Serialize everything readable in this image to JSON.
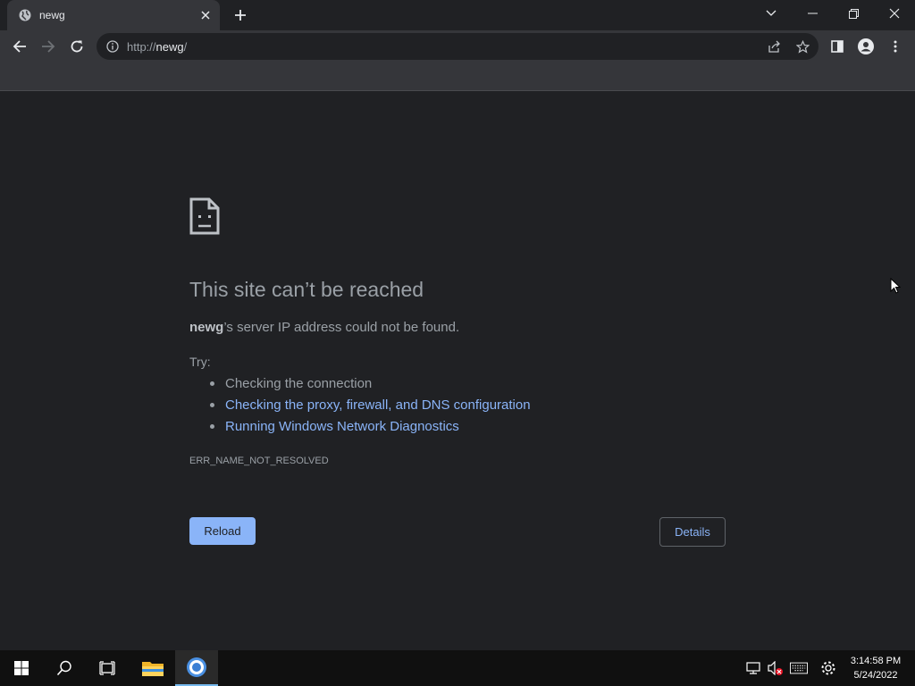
{
  "browser": {
    "tab": {
      "title": "newg",
      "favicon": "globe-icon"
    },
    "url": {
      "prefix": "http://",
      "host": "newg",
      "suffix": "/"
    }
  },
  "page": {
    "title": "This site can’t be reached",
    "desc_host": "newg",
    "desc_rest": "’s server IP address could not be found.",
    "try_label": "Try:",
    "suggestions": [
      {
        "text": "Checking the connection",
        "link": false
      },
      {
        "text": "Checking the proxy, firewall, and DNS configuration",
        "link": true
      },
      {
        "text": "Running Windows Network Diagnostics",
        "link": true
      }
    ],
    "error_code": "ERR_NAME_NOT_RESOLVED",
    "reload_label": "Reload",
    "details_label": "Details"
  },
  "taskbar": {
    "time": "3:14:58 PM",
    "date": "5/24/2022"
  },
  "colors": {
    "accent": "#8ab4f8",
    "background": "#202124",
    "toolbar": "#35363a"
  }
}
